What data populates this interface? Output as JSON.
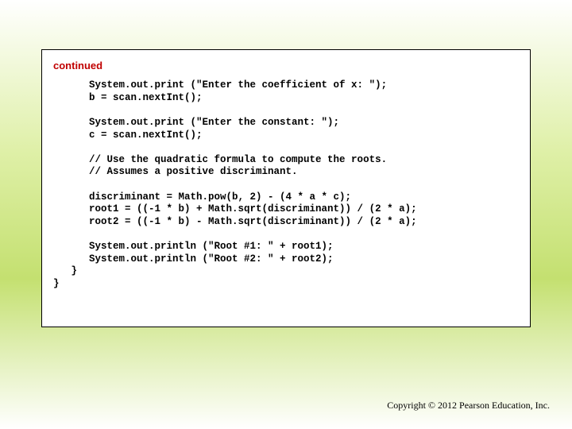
{
  "label": "continued",
  "code": "      System.out.print (\"Enter the coefficient of x: \");\n      b = scan.nextInt();\n\n      System.out.print (\"Enter the constant: \");\n      c = scan.nextInt();\n\n      // Use the quadratic formula to compute the roots.\n      // Assumes a positive discriminant.\n\n      discriminant = Math.pow(b, 2) - (4 * a * c);\n      root1 = ((-1 * b) + Math.sqrt(discriminant)) / (2 * a);\n      root2 = ((-1 * b) - Math.sqrt(discriminant)) / (2 * a);\n\n      System.out.println (\"Root #1: \" + root1);\n      System.out.println (\"Root #2: \" + root2);\n   }\n}",
  "copyright": "Copyright © 2012 Pearson Education, Inc."
}
